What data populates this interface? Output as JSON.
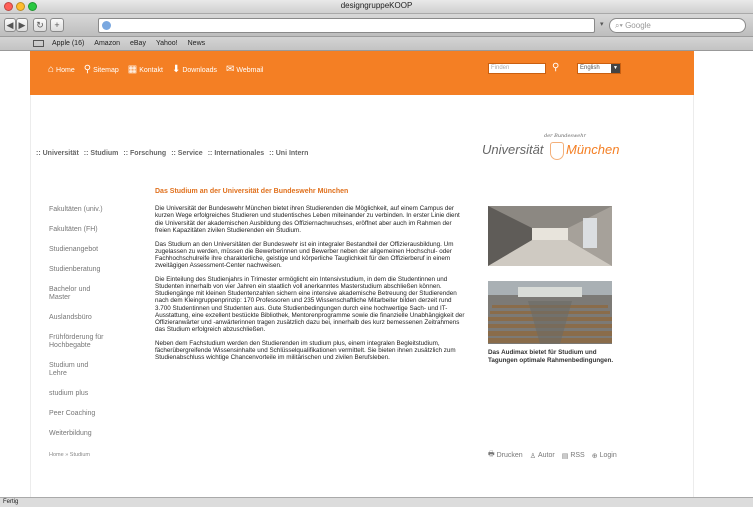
{
  "browser": {
    "window_title": "designgruppeKOOP",
    "search_placeholder": "Google",
    "bookmarks": [
      "Apple (16)",
      "Amazon",
      "eBay",
      "Yahoo!",
      "News"
    ],
    "status": "Fertig"
  },
  "header": {
    "nav": [
      {
        "label": "Home",
        "icon": "home-icon"
      },
      {
        "label": "Sitemap",
        "icon": "sitemap-icon"
      },
      {
        "label": "Kontakt",
        "icon": "contact-icon"
      },
      {
        "label": "Downloads",
        "icon": "download-icon"
      },
      {
        "label": "Webmail",
        "icon": "mail-icon"
      }
    ],
    "search_placeholder": "Finden",
    "language": "English",
    "accent_color": "#f47f24"
  },
  "mainnav": [
    ":: Universität",
    ":: Studium",
    ":: Forschung",
    ":: Service",
    ":: Internationales",
    ":: Uni Intern"
  ],
  "logo": {
    "small": "der Bundeswehr",
    "uni": "Universität",
    "city": "München"
  },
  "sidebar": [
    "Fakultäten (univ.)",
    "Fakultäten (FH)",
    "Studienangebot",
    "Studienberatung",
    "Bachelor und Master",
    "Auslandsbüro",
    "Frühförderung für Hochbegabte",
    "Studium und Lehre",
    "studium plus",
    "Peer Coaching",
    "Weiterbildung"
  ],
  "content": {
    "title": "Das Studium an der Universität der Bundeswehr München",
    "paragraphs": [
      "Die Universität der Bundeswehr München bietet ihren Studierenden die Möglichkeit, auf einem Campus der kurzen Wege erfolgreiches Studieren und studentisches Leben miteinander zu verbinden. In erster Linie dient die Universität der akademischen Ausbildung des Offiziernachwuchses, eröffnet aber auch im Rahmen der freien Kapazitäten zivilen Studierenden ein Studium.",
      "Das Studium an den Universitäten der Bundeswehr ist ein integraler Bestandteil der Offizierausbildung. Um zugelassen zu werden, müssen die Bewerberinnen und Bewerber neben der allgemeinen Hochschul- oder Fachhochschulreife ihre charakterliche, geistige und körperliche Tauglichkeit für den Offizierberuf in einem zweitägigen Assessment-Center nachweisen.",
      "Die Einteilung des Studienjahrs in Trimester ermöglicht ein Intensivstudium, in dem die Studentinnen und Studenten innerhalb von vier Jahren ein staatlich voll anerkanntes Masterstudium abschließen können. Studiengänge mit kleinen Studentenzahlen sichern eine intensive akademische Betreuung der Studierenden nach dem Kleingruppenprinzip: 170 Professoren und 235 Wissenschaftliche Mitarbeiter bilden derzeit rund 3.700 Studentinnen und Studenten aus. Gute Studienbedingungen durch eine hochwertige Sach- und IT-Ausstattung, eine exzellent bestückte Bibliothek, Mentorenprogramme sowie die finanzielle Unabhängigkeit der Offizieranwärter und -anwärterinnen tragen zusätzlich dazu bei, innerhalb des kurz bemessenen Zeitrahmens das Studium erfolgreich abzuschließen.",
      "Neben dem Fachstudium werden den Studierenden im studium plus, einem integralen Begleitstudium, fächerübergreifende Wissensinhalte und Schlüsselqualifikationen vermittelt. Sie bieten ihnen zusätzlich zum Studienabschluss wichtige Chancenvorteile im militärischen und zivilen Berufsleben."
    ]
  },
  "caption": "Das Audimax bietet für Studium und Tagungen optimale Rahmenbedingungen.",
  "breadcrumb": "Home » Studium",
  "footer_links": [
    {
      "label": "Drucken",
      "icon": "print-icon"
    },
    {
      "label": "Autor",
      "icon": "author-icon"
    },
    {
      "label": "RSS",
      "icon": "rss-icon"
    },
    {
      "label": "Login",
      "icon": "login-icon"
    }
  ]
}
